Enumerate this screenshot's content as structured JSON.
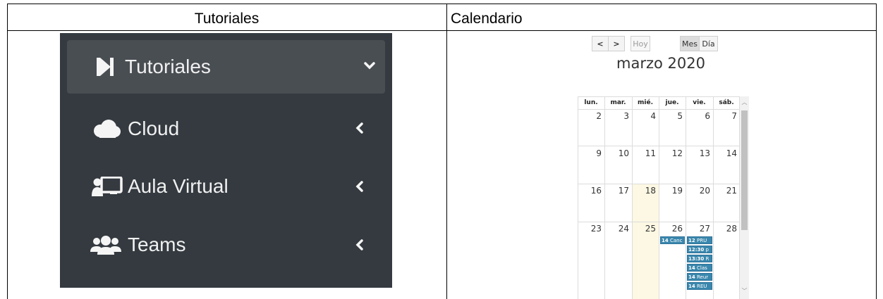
{
  "table": {
    "col_left_header": "Tutoriales",
    "col_right_header": "Calendario"
  },
  "sidebar": {
    "items": [
      {
        "label": "Tutoriales",
        "icon": "play-bar-icon",
        "chevron": "chevron-down-icon",
        "active": true
      },
      {
        "label": "Cloud",
        "icon": "cloud-icon",
        "chevron": "chevron-left-icon"
      },
      {
        "label": "Aula Virtual",
        "icon": "chalkboard-teacher-icon",
        "chevron": "chevron-left-icon"
      },
      {
        "label": "Teams",
        "icon": "users-icon",
        "chevron": "chevron-left-icon"
      }
    ],
    "colors": {
      "background": "#343a40",
      "active": "#494e53",
      "text": "#f0f0f0"
    }
  },
  "calendar": {
    "buttons": {
      "prev": "<",
      "next": ">",
      "today": "Hoy",
      "month": "Mes",
      "day": "Día"
    },
    "title": "marzo 2020",
    "weekdays": [
      "lun.",
      "mar.",
      "mié.",
      "jue.",
      "vie.",
      "sáb."
    ],
    "weeks": [
      [
        "2",
        "3",
        "4",
        "5",
        "6",
        "7"
      ],
      [
        "9",
        "10",
        "11",
        "12",
        "13",
        "14"
      ],
      [
        "16",
        "17",
        "18",
        "19",
        "20",
        "21"
      ],
      [
        "23",
        "24",
        "25",
        "26",
        "27",
        "28"
      ]
    ],
    "today_day": "25",
    "events": {
      "thu_26": [
        {
          "time": "14",
          "title": "Canc"
        }
      ],
      "fri_27": [
        {
          "time": "12",
          "title": "PRU"
        },
        {
          "time": "12:30",
          "title": "p"
        },
        {
          "time": "13:30",
          "title": "R"
        },
        {
          "time": "14",
          "title": "Clas"
        },
        {
          "time": "14",
          "title": "Reur"
        },
        {
          "time": "14",
          "title": "REU"
        }
      ]
    },
    "colors": {
      "event": "#3a87ad",
      "today": "#fcf8e3"
    }
  }
}
